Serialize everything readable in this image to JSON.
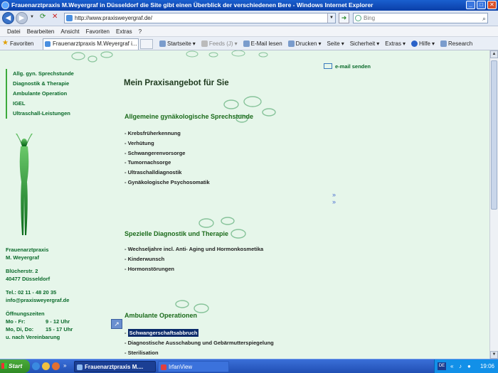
{
  "window": {
    "title": "Frauenarztpraxis M.Weyergraf in Düsseldorf die Site gibt einen Überblick der verschiedenen Bere - Windows Internet Explorer"
  },
  "address_bar": {
    "url": "http://www.praxisweyergraf.de/",
    "search_placeholder": "Bing"
  },
  "menu": [
    "Datei",
    "Bearbeiten",
    "Ansicht",
    "Favoriten",
    "Extras",
    "?"
  ],
  "command_bar": {
    "favorites_label": "Favoriten",
    "tab_label": "Frauenarztpraxis M.Weyergraf i...",
    "items": [
      "Startseite",
      "Feeds (J)",
      "E-Mail lesen",
      "Drucken",
      "Seite",
      "Sicherheit",
      "Extras",
      "Hilfe",
      "Research"
    ]
  },
  "page": {
    "left_nav": [
      "Allg. gyn. Sprechstunde",
      "Diagnostik & Therapie",
      "Ambulante Operation",
      "IGEL",
      "Ultraschall-Leistungen"
    ],
    "contact": {
      "name1": "Frauenarztpraxis",
      "name2": "M. Weyergraf",
      "street": "Blücherstr. 2",
      "city": "40477 Düsseldorf",
      "phone": "Tel.: 02 11 - 48 20 35",
      "email": "info@praxisweyergraf.de",
      "hours_title": "Öffnungszeiten",
      "hours": [
        {
          "days": "Mo - Fr:",
          "time": "9 - 12 Uhr"
        },
        {
          "days": "Mo, Di, Do:",
          "time": "15 - 17 Uhr"
        }
      ],
      "hours_note": "u. nach Vereinbarung"
    },
    "email_link": "e-mail senden",
    "title": "Mein Praxisangebot für Sie",
    "sections": [
      {
        "title": "Allgemeine gynäkologische Sprechstunde",
        "items": [
          "Krebsfrüherkennung",
          "Verhütung",
          "Schwangerenvorsorge",
          "Tumornachsorge",
          "Ultraschalldiagnostik",
          "Gynäkologische Psychosomatik"
        ]
      },
      {
        "title": "Spezielle Diagnostik und Therapie",
        "items": [
          "Wechseljahre incl. Anti- Aging und Hormonkosmetika",
          "Kinderwunsch",
          "Hormonstörungen"
        ]
      },
      {
        "title": "Ambulante Operationen",
        "items": [
          "Schwangerschaftsabbruch",
          "Diagnostische Ausschabung und Gebärmutterspiegelung",
          "Sterilisation"
        ]
      }
    ]
  },
  "taskbar": {
    "start_label": "Start",
    "task1": "Frauenarztpraxis M....",
    "task2": "IrfanView",
    "lang": "DE",
    "clock": "19:06"
  }
}
